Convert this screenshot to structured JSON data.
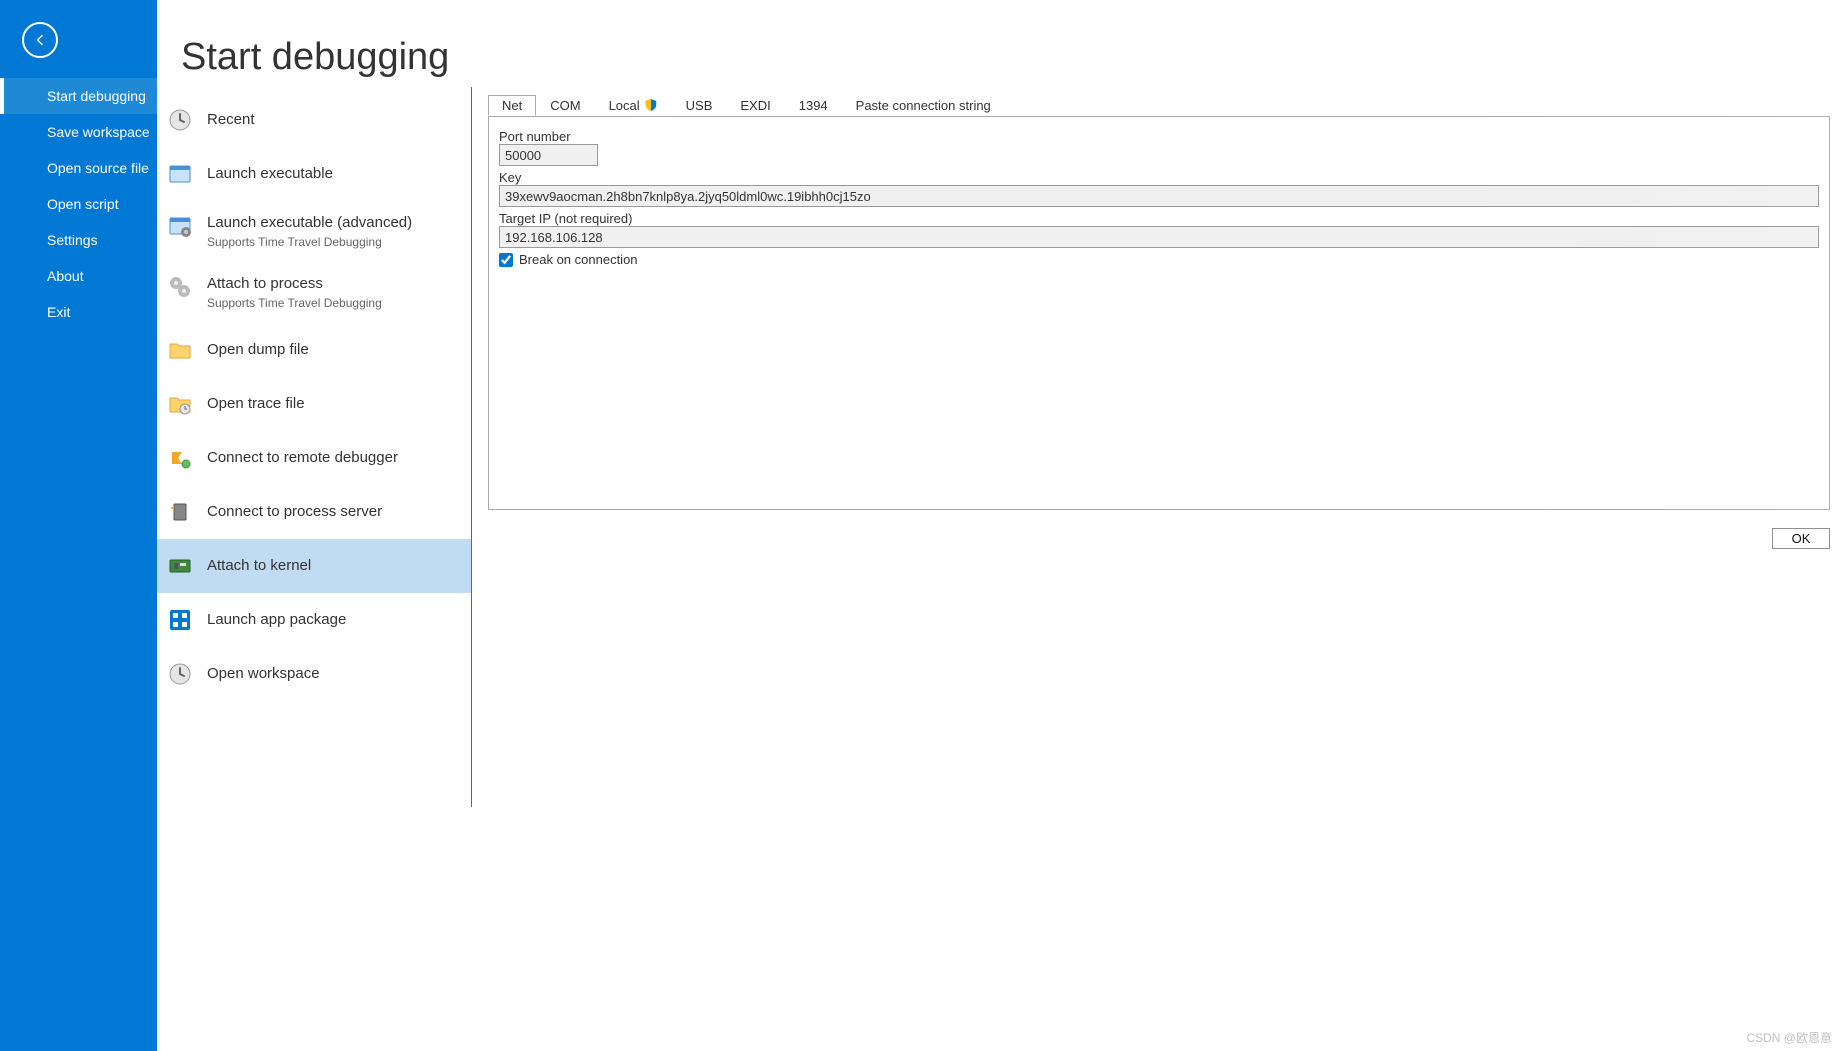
{
  "page": {
    "title": "Start debugging"
  },
  "sidebar": {
    "items": [
      {
        "label": "Start debugging",
        "active": true
      },
      {
        "label": "Save workspace"
      },
      {
        "label": "Open source file"
      },
      {
        "label": "Open script"
      },
      {
        "label": "Settings"
      },
      {
        "label": "About"
      },
      {
        "label": "Exit"
      }
    ]
  },
  "actions": {
    "recent": "Recent",
    "launch_exe": "Launch executable",
    "launch_adv": "Launch executable (advanced)",
    "launch_adv_sub": "Supports Time Travel Debugging",
    "attach_proc": "Attach to process",
    "attach_proc_sub": "Supports Time Travel Debugging",
    "open_dump": "Open dump file",
    "open_trace": "Open trace file",
    "connect_remote": "Connect to remote debugger",
    "connect_process_server": "Connect to process server",
    "attach_kernel": "Attach to kernel",
    "launch_app_pkg": "Launch app package",
    "open_workspace": "Open workspace"
  },
  "tabs": {
    "net": "Net",
    "com": "COM",
    "local": "Local",
    "usb": "USB",
    "exdi": "EXDI",
    "f1394": "1394",
    "paste": "Paste connection string"
  },
  "form": {
    "port_label": "Port number",
    "port_value": "50000",
    "key_label": "Key",
    "key_value": "39xewv9aocman.2h8bn7knlp8ya.2jyq50ldml0wc.19ibhh0cj15zo",
    "target_label": "Target IP (not required)",
    "target_value": "192.168.106.128",
    "break_label": "Break on connection",
    "break_checked": true,
    "ok_label": "OK"
  },
  "watermark": "CSDN @欧恩意"
}
